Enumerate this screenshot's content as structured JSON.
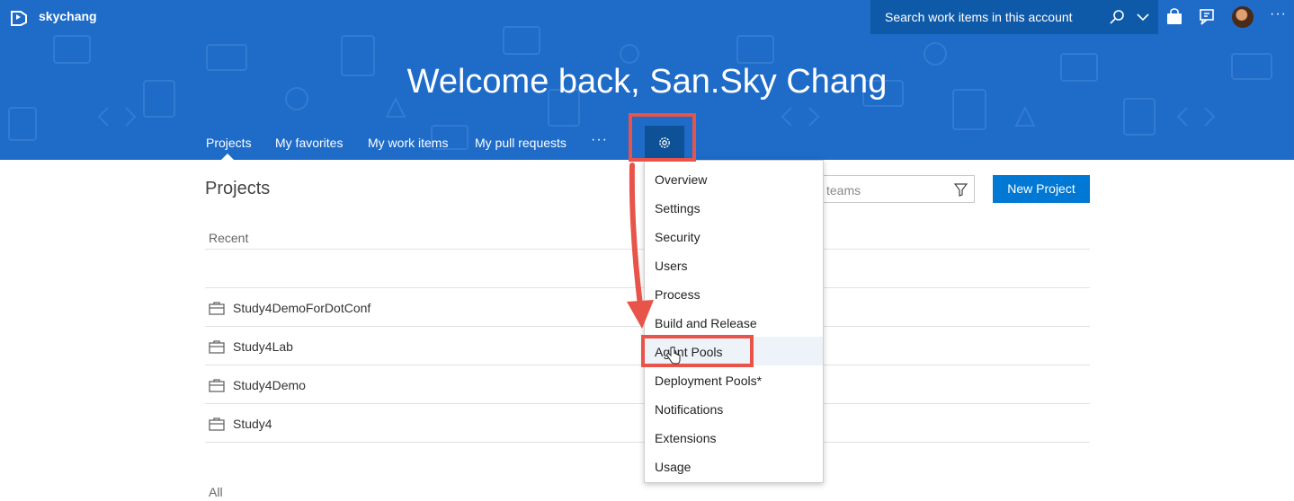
{
  "topbar": {
    "account_name": "skychang",
    "search_placeholder": "Search work items in this account",
    "icons": [
      "vsts-logo-icon",
      "search-icon",
      "chevron-down-icon",
      "marketplace-bag-icon",
      "feedback-icon",
      "avatar",
      "more-icon"
    ],
    "more_label": "···"
  },
  "hero": {
    "welcome": "Welcome back, San.Sky Chang"
  },
  "nav": {
    "tabs": [
      {
        "label": "Projects",
        "active": true
      },
      {
        "label": "My favorites"
      },
      {
        "label": "My work items"
      },
      {
        "label": "My pull requests"
      }
    ],
    "more_label": "···"
  },
  "main": {
    "title": "Projects",
    "filter_placeholder": "teams",
    "new_project_label": "New Project",
    "recent_label": "Recent",
    "all_label": "All",
    "recent_projects": [
      "Study4DemoForDotConf",
      "Study4Lab",
      "Study4Demo",
      "Study4"
    ]
  },
  "settings_menu": {
    "items": [
      "Overview",
      "Settings",
      "Security",
      "Users",
      "Process",
      "Build and Release",
      "Agent Pools",
      "Deployment Pools*",
      "Notifications",
      "Extensions",
      "Usage"
    ],
    "highlighted_item": "Agent Pools"
  },
  "colors": {
    "header_blue": "#1e6bc8",
    "primary_button": "#0078d4",
    "annotation_red": "#e8544a"
  }
}
